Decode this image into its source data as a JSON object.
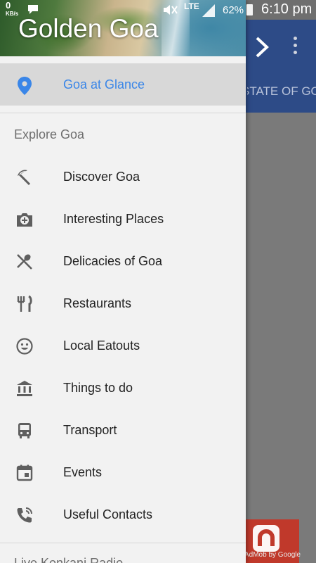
{
  "status_bar": {
    "data_speed": "0",
    "data_unit": "KB/s",
    "network": "LTE",
    "battery": "62%",
    "time": "6:10 pm"
  },
  "background_app": {
    "subtitle": "STATE OF GOA",
    "ad_text": "AdMob by Google"
  },
  "drawer": {
    "title": "Golden Goa",
    "active_item": {
      "label": "Goa at Glance",
      "icon": "location-pin-icon",
      "color": "#3a86e8"
    },
    "section_header": "Explore Goa",
    "items": [
      {
        "label": "Discover Goa",
        "icon": "beach-umbrella-icon"
      },
      {
        "label": "Interesting Places",
        "icon": "camera-add-icon"
      },
      {
        "label": "Delicacies of Goa",
        "icon": "spoon-fork-cross-icon"
      },
      {
        "label": "Restaurants",
        "icon": "fork-knife-icon"
      },
      {
        "label": "Local Eatouts",
        "icon": "smiley-icon"
      },
      {
        "label": "Things to do",
        "icon": "museum-icon"
      },
      {
        "label": "Transport",
        "icon": "bus-icon"
      },
      {
        "label": "Events",
        "icon": "calendar-icon"
      },
      {
        "label": "Useful Contacts",
        "icon": "phone-call-icon"
      }
    ],
    "next_section_header": "Live Konkani Radio"
  },
  "colors": {
    "toolbar": "#2d4b87",
    "drawer_bg": "#f2f2f2",
    "active_bg": "#d8d8d8",
    "icon": "#5f5f5f"
  }
}
